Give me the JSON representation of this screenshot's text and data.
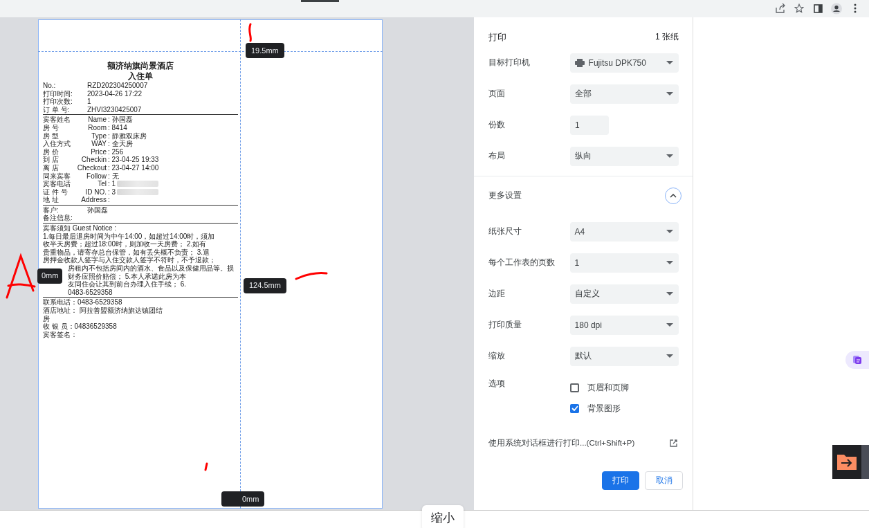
{
  "preview": {
    "receipt": {
      "title": "额济纳旗尚景酒店",
      "subtitle": "入住单",
      "header_fields": [
        {
          "label": "No.:",
          "value": "RZD202304250007"
        },
        {
          "label": "打印时间:",
          "value": "2023-04-26 17:22"
        },
        {
          "label": "打印次数:",
          "value": "1"
        },
        {
          "label": "订 单 号:",
          "value": "ZHVI3230425007"
        }
      ],
      "guest_fields": [
        {
          "cn": "宾客姓名",
          "en": "Name",
          "value": ": 孙国磊",
          "redacted": false
        },
        {
          "cn": "房 号",
          "en": "Room",
          "value": ": 8414",
          "redacted": false
        },
        {
          "cn": "房 型",
          "en": "Type",
          "value": ": 静雅双床房",
          "redacted": false
        },
        {
          "cn": "入住方式",
          "en": "WAY",
          "value": ": 全天房",
          "redacted": false
        },
        {
          "cn": "房 价",
          "en": "Price",
          "value": ": 256",
          "redacted": false
        },
        {
          "cn": "到 店",
          "en": "Checkin",
          "value": ": 23-04-25 19:33",
          "redacted": false
        },
        {
          "cn": "离 店",
          "en": "Checkout",
          "value": ": 23-04-27 14:00",
          "redacted": false
        },
        {
          "cn": "同来宾客",
          "en": "Follow",
          "value": ": 无",
          "redacted": false
        },
        {
          "cn": "宾客电话",
          "en": "Tel",
          "value": ": 1",
          "redacted": true
        },
        {
          "cn": "证 件 号",
          "en": "ID NO.",
          "value": ": 3",
          "redacted": true
        },
        {
          "cn": "地 址",
          "en": "Address",
          "value": ":",
          "redacted": false
        }
      ],
      "customer": {
        "label": "客户:",
        "value": "孙国磊"
      },
      "remarks_label": "备注信息:",
      "notice_title": "宾客须知 Guest Notice :",
      "notice_lines": [
        {
          "text": "1.每日最后退房时间为中午14:00，如超过14:00时，须加",
          "kind": "full"
        },
        {
          "text": "收半天房费；超过18:00时，则加收一天房费； 2.如有",
          "kind": "full"
        },
        {
          "text": "贵重物品，请寄存总台保管，如有丢失概不负责； 3.退",
          "kind": "full"
        },
        {
          "text": "房押金收款人签字与入住交款人签字不符时，不予退款；",
          "kind": "full"
        },
        {
          "text": "房租内不包括房间内的酒水、食品以及保健用品等。损",
          "kind": "indented"
        },
        {
          "text": "财务应照价赔偿； 5.本人承诺此房为本",
          "kind": "indented"
        },
        {
          "text": "友同住会让其到前台办理入住手续； 6.",
          "kind": "indented"
        },
        {
          "text": "0483-6529358",
          "kind": "indented"
        }
      ],
      "footer_lines": [
        {
          "text": "联系电话：0483-6529358"
        },
        {
          "text": "酒店地址： 阿拉善盟额济纳旗达镇团结"
        },
        {
          "text": "房"
        },
        {
          "text": "收 银 员：04836529358"
        },
        {
          "text": "宾客签名："
        }
      ]
    },
    "margin_tags": [
      {
        "text": "19.5mm",
        "kind": "top"
      },
      {
        "text": "0mm",
        "kind": "left"
      },
      {
        "text": "124.5mm",
        "kind": "right"
      },
      {
        "text": "0mm",
        "kind": "bottom"
      }
    ]
  },
  "settings": {
    "title": "打印",
    "sheet_count": "1 张纸",
    "fields": [
      {
        "label": "目标打印机",
        "kind": "printer",
        "value": "Fujitsu DPK750"
      },
      {
        "label": "页面",
        "kind": "select",
        "value": "全部"
      },
      {
        "label": "份数",
        "kind": "number",
        "value": "1"
      },
      {
        "label": "布局",
        "kind": "select",
        "value": "纵向"
      }
    ],
    "more_settings": {
      "label": "更多设置",
      "expanded": true
    },
    "advanced_fields": [
      {
        "label": "纸张尺寸",
        "kind": "select",
        "value": "A4"
      },
      {
        "label": "每个工作表的页数",
        "kind": "select",
        "value": "1"
      },
      {
        "label": "边距",
        "kind": "select",
        "value": "自定义"
      },
      {
        "label": "打印质量",
        "kind": "select",
        "value": "180 dpi"
      },
      {
        "label": "缩放",
        "kind": "select",
        "value": "默认"
      }
    ],
    "options": {
      "label": "选项",
      "checkboxes": [
        {
          "label": "页眉和页脚",
          "checked": false
        },
        {
          "label": "背景图形",
          "checked": true
        }
      ]
    },
    "system_dialog_link": "使用系统对话框进行打印...(Ctrl+Shift+P)",
    "buttons": [
      {
        "label": "打印",
        "kind": "primary"
      },
      {
        "label": "取消",
        "kind": "secondary"
      }
    ]
  },
  "tooltip": "缩小"
}
